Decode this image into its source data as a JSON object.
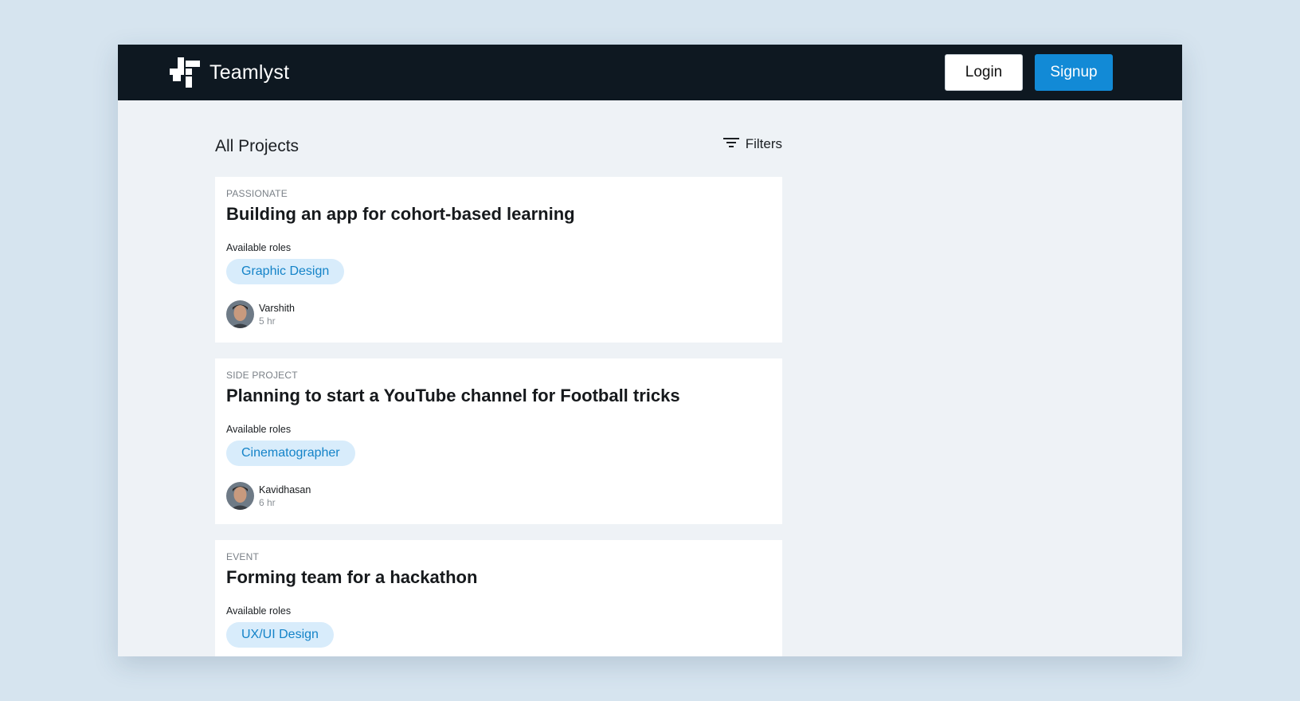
{
  "app": {
    "name": "Teamlyst"
  },
  "nav": {
    "login_label": "Login",
    "signup_label": "Signup"
  },
  "list": {
    "title": "All Projects",
    "filters_label": "Filters"
  },
  "projects": [
    {
      "category": "PASSIONATE",
      "title": "Building an app for cohort-based learning",
      "roles_label": "Available roles",
      "role": "Graphic Design",
      "owner": "Varshith",
      "time": "5 hr"
    },
    {
      "category": "SIDE PROJECT",
      "title": "Planning to start a YouTube channel for Football tricks",
      "roles_label": "Available roles",
      "role": "Cinematographer",
      "owner": "Kavidhasan",
      "time": "6 hr"
    },
    {
      "category": "EVENT",
      "title": "Forming team for a hackathon",
      "roles_label": "Available roles",
      "role": "UX/UI Design"
    }
  ],
  "colors": {
    "page_bg": "#d6e4ef",
    "navbar_bg": "#0e1821",
    "accent": "#128ad6",
    "chip_bg": "#d8ecfb",
    "chip_text": "#1483c8"
  },
  "icons": [
    "logo-icon",
    "filter-icon",
    "avatar-icon"
  ]
}
